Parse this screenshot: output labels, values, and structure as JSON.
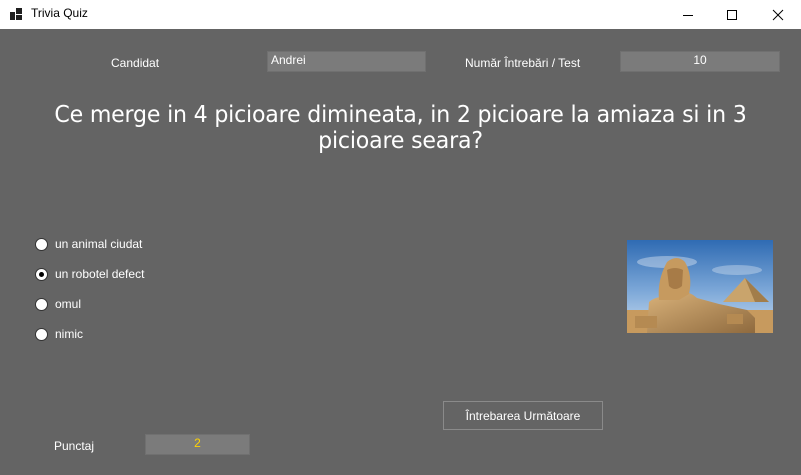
{
  "window": {
    "title": "Trivia Quiz",
    "minimize_icon": "minimize-icon",
    "maximize_icon": "maximize-icon",
    "close_icon": "close-icon"
  },
  "header": {
    "candidate_label": "Candidat",
    "candidate_value": "Andrei",
    "questions_label": "Număr Întrebări / Test",
    "questions_value": "10"
  },
  "question": {
    "text": "Ce merge in 4 picioare dimineata, in 2 picioare la amiaza si in 3 picioare seara?",
    "image_icon": "sphinx-image"
  },
  "options": [
    {
      "label": "un animal ciudat",
      "selected": false
    },
    {
      "label": "un robotel defect",
      "selected": true
    },
    {
      "label": "omul",
      "selected": false
    },
    {
      "label": "nimic",
      "selected": false
    }
  ],
  "footer": {
    "score_label": "Punctaj",
    "score_value": "2",
    "next_button": "Întrebarea Următoare"
  },
  "colors": {
    "background": "#646464",
    "field_background": "#7b7b7b",
    "score_text": "#ffd200"
  }
}
